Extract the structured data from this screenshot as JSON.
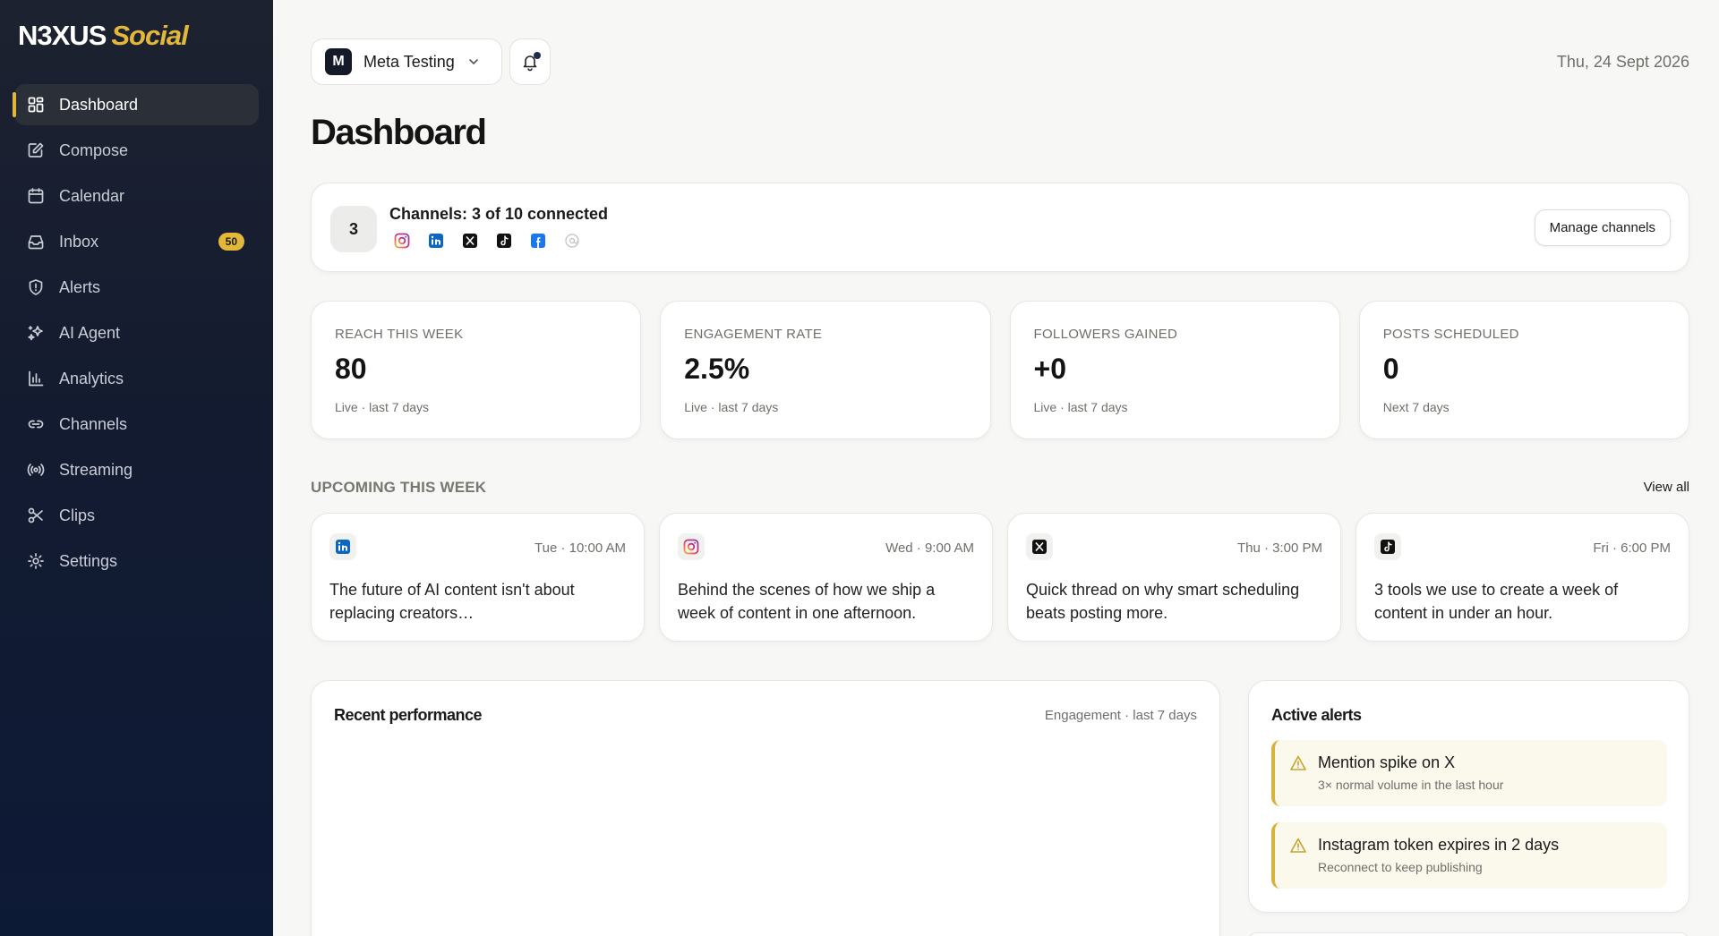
{
  "brand": {
    "name_a": "N3XUS",
    "name_b": "Social",
    "accent": "#e3b83a"
  },
  "sidebar": {
    "items": [
      {
        "label": "Dashboard",
        "icon": "grid-icon"
      },
      {
        "label": "Compose",
        "icon": "compose-icon"
      },
      {
        "label": "Calendar",
        "icon": "calendar-icon"
      },
      {
        "label": "Inbox",
        "icon": "inbox-icon",
        "badge": "50"
      },
      {
        "label": "Alerts",
        "icon": "shield-icon"
      },
      {
        "label": "AI Agent",
        "icon": "sparkles-icon"
      },
      {
        "label": "Analytics",
        "icon": "bar-chart-icon"
      },
      {
        "label": "Channels",
        "icon": "link-icon"
      },
      {
        "label": "Streaming",
        "icon": "broadcast-icon"
      },
      {
        "label": "Clips",
        "icon": "scissors-icon"
      },
      {
        "label": "Settings",
        "icon": "gear-icon"
      }
    ]
  },
  "header": {
    "workspace_initial": "M",
    "workspace_name": "Meta Testing",
    "date": "Thu, 24 Sept 2026"
  },
  "page": {
    "title": "Dashboard"
  },
  "channels": {
    "count": "3",
    "title": "Channels: 3 of 10 connected",
    "icons": [
      "instagram-icon",
      "linkedin-icon",
      "x-icon",
      "tiktok-icon",
      "facebook-icon",
      "threads-icon"
    ],
    "manage_label": "Manage channels"
  },
  "stats": [
    {
      "label": "REACH THIS WEEK",
      "value": "80",
      "sub": "Live · last 7 days"
    },
    {
      "label": "ENGAGEMENT RATE",
      "value": "2.5%",
      "sub": "Live · last 7 days"
    },
    {
      "label": "FOLLOWERS GAINED",
      "value": "+0",
      "sub": "Live · last 7 days"
    },
    {
      "label": "POSTS SCHEDULED",
      "value": "0",
      "sub": "Next 7 days"
    }
  ],
  "upcoming": {
    "title": "UPCOMING THIS WEEK",
    "view_all": "View all",
    "posts": [
      {
        "network": "linkedin-icon",
        "time": "Tue · 10:00 AM",
        "text": "The future of AI content isn't about replacing creators…"
      },
      {
        "network": "instagram-icon",
        "time": "Wed · 9:00 AM",
        "text": "Behind the scenes of how we ship a week of content in one afternoon."
      },
      {
        "network": "x-icon",
        "time": "Thu · 3:00 PM",
        "text": "Quick thread on why smart scheduling beats posting more."
      },
      {
        "network": "tiktok-icon",
        "time": "Fri · 6:00 PM",
        "text": "3 tools we use to create a week of content in under an hour."
      }
    ]
  },
  "performance": {
    "title": "Recent performance",
    "subtitle": "Engagement · last 7 days"
  },
  "alerts": {
    "title": "Active alerts",
    "items": [
      {
        "title": "Mention spike on X",
        "desc": "3× normal volume in the last hour"
      },
      {
        "title": "Instagram token expires in 2 days",
        "desc": "Reconnect to keep publishing"
      }
    ]
  }
}
